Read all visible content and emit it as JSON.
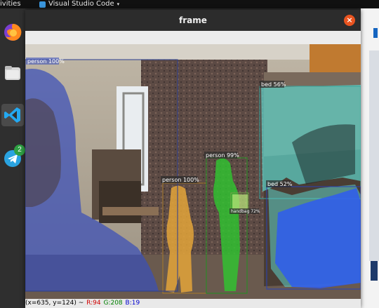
{
  "topbar": {
    "activities": "ivities",
    "app_name": "Visual Studio Code",
    "caret": "▾"
  },
  "dock": {
    "items": [
      {
        "name": "firefox-icon"
      },
      {
        "name": "files-icon"
      },
      {
        "name": "vscode-icon",
        "active": true
      },
      {
        "name": "telegram-icon",
        "badge": "2"
      }
    ]
  },
  "window": {
    "title": "frame",
    "close_glyph": "×"
  },
  "detections": {
    "labels": {
      "person_left": "person 100%",
      "person_orange": "person 100%",
      "person_green": "person 99%",
      "handbag": "handbag 72%",
      "bed_top": "bed 56%",
      "bed_bottom": "bed 52%"
    },
    "colors": {
      "person_left": "#3a4fb8",
      "person_orange": "#e3a53a",
      "person_green": "#2fc52f",
      "handbag": "#b8e27a",
      "bed_top": "#5ed1c8",
      "bed_bottom": "#2f5cf0"
    }
  },
  "status": {
    "coords": "(x=635, y=124) ~",
    "r": "R:94",
    "g": "G:208",
    "b": "B:19"
  }
}
